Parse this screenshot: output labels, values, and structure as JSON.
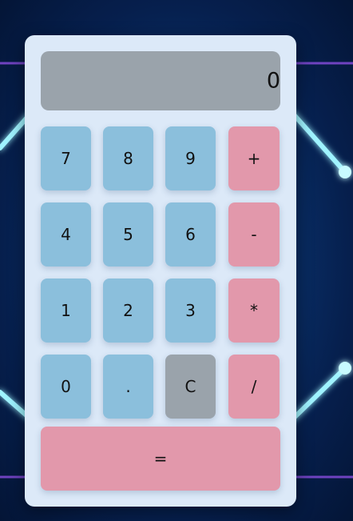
{
  "display": {
    "value": "0"
  },
  "keys": {
    "seven": "7",
    "eight": "8",
    "nine": "9",
    "plus": "+",
    "four": "4",
    "five": "5",
    "six": "6",
    "minus": "-",
    "one": "1",
    "two": "2",
    "three": "3",
    "multiply": "*",
    "zero": "0",
    "decimal": ".",
    "clear": "C",
    "divide": "/",
    "equals": "="
  },
  "colors": {
    "number_key": "#8bbfdc",
    "operator_key": "#e298ab",
    "clear_key": "#9aa3ab",
    "display_bg": "#9aa3ab",
    "panel_bg": "#dce9f8",
    "page_bg": "#0a3470",
    "glow_line": "#9ff3ff"
  }
}
